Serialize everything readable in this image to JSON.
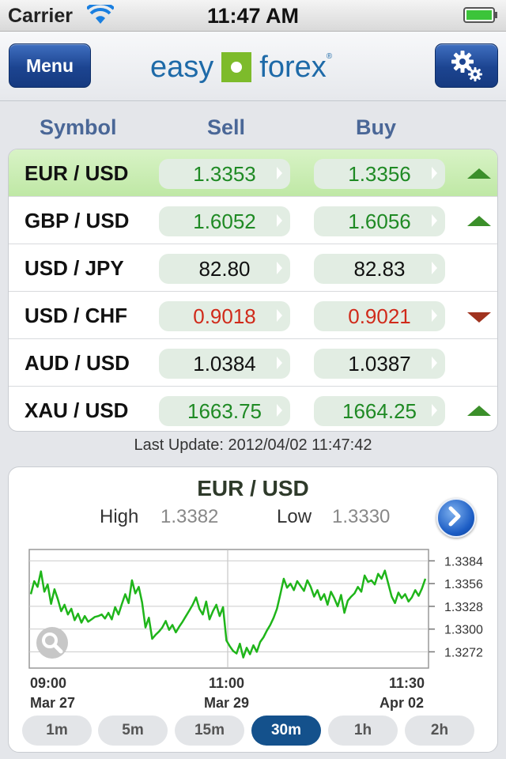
{
  "status": {
    "carrier": "Carrier",
    "time": "11:47 AM"
  },
  "header": {
    "menu_label": "Menu",
    "logo_left": "easy",
    "logo_right": "forex",
    "logo_mark": "®"
  },
  "columns": {
    "symbol": "Symbol",
    "sell": "Sell",
    "buy": "Buy"
  },
  "colors": {
    "up": "#1f8a24",
    "down": "#d02a1a",
    "neutral": "#111111",
    "accent": "#14518c",
    "chart_line": "#1fb51a"
  },
  "rates": [
    {
      "symbol": "EUR / USD",
      "sell": "1.3353",
      "buy": "1.3356",
      "trend": "up",
      "color": "up",
      "selected": true
    },
    {
      "symbol": "GBP / USD",
      "sell": "1.6052",
      "buy": "1.6056",
      "trend": "up",
      "color": "up",
      "selected": false
    },
    {
      "symbol": "USD / JPY",
      "sell": "82.80",
      "buy": "82.83",
      "trend": "none",
      "color": "neutral",
      "selected": false
    },
    {
      "symbol": "USD / CHF",
      "sell": "0.9018",
      "buy": "0.9021",
      "trend": "down",
      "color": "down",
      "selected": false
    },
    {
      "symbol": "AUD / USD",
      "sell": "1.0384",
      "buy": "1.0387",
      "trend": "none",
      "color": "neutral",
      "selected": false
    },
    {
      "symbol": "XAU / USD",
      "sell": "1663.75",
      "buy": "1664.25",
      "trend": "up",
      "color": "up",
      "selected": false
    }
  ],
  "last_update": "Last Update: 2012/04/02 11:47:42",
  "chart": {
    "title": "EUR / USD",
    "high_label": "High",
    "high_value": "1.3382",
    "low_label": "Low",
    "low_value": "1.3330",
    "y_ticks": [
      "1.3384",
      "1.3356",
      "1.3328",
      "1.3300",
      "1.3272"
    ],
    "x_labels": [
      {
        "time": "09:00",
        "date": "Mar 27"
      },
      {
        "time": "11:00",
        "date": "Mar 29"
      },
      {
        "time": "11:30",
        "date": "Apr 02"
      }
    ]
  },
  "chart_data": {
    "type": "line",
    "ylim": [
      1.3252,
      1.3398
    ],
    "y_ticks": [
      1.3384,
      1.3356,
      1.3328,
      1.33,
      1.3272
    ],
    "series": [
      {
        "values": [
          1.3343,
          1.3359,
          1.3352,
          1.3371,
          1.3346,
          1.3355,
          1.3331,
          1.3349,
          1.3337,
          1.3322,
          1.333,
          1.3318,
          1.3325,
          1.3311,
          1.3319,
          1.3308,
          1.3316,
          1.3309,
          1.3312,
          1.3315,
          1.3316,
          1.3318,
          1.3313,
          1.332,
          1.3312,
          1.3327,
          1.3318,
          1.3331,
          1.3343,
          1.3332,
          1.336,
          1.3344,
          1.3352,
          1.3333,
          1.3302,
          1.3314,
          1.3288,
          1.3293,
          1.3297,
          1.3302,
          1.331,
          1.3299,
          1.3305,
          1.3296,
          1.3303,
          1.3309,
          1.3316,
          1.3323,
          1.333,
          1.3339,
          1.3325,
          1.3318,
          1.3334,
          1.3312,
          1.3322,
          1.333,
          1.3316,
          1.3327,
          1.3286,
          1.3279,
          1.3273,
          1.327,
          1.3282,
          1.3265,
          1.3277,
          1.3269,
          1.328,
          1.3272,
          1.3284,
          1.329,
          1.3298,
          1.3305,
          1.3314,
          1.3325,
          1.3343,
          1.3362,
          1.3351,
          1.3356,
          1.3348,
          1.3359,
          1.3353,
          1.3347,
          1.336,
          1.3352,
          1.334,
          1.3348,
          1.3336,
          1.3343,
          1.333,
          1.3346,
          1.3338,
          1.3328,
          1.3342,
          1.332,
          1.3335,
          1.334,
          1.3344,
          1.3352,
          1.3346,
          1.3366,
          1.3358,
          1.336,
          1.3355,
          1.3368,
          1.3362,
          1.3372,
          1.3356,
          1.334,
          1.3332,
          1.3345,
          1.3338,
          1.3343,
          1.3334,
          1.3339,
          1.3348,
          1.3341,
          1.335,
          1.3362
        ]
      }
    ]
  },
  "timeframes": [
    "1m",
    "5m",
    "15m",
    "30m",
    "1h",
    "2h"
  ],
  "active_timeframe": 3
}
